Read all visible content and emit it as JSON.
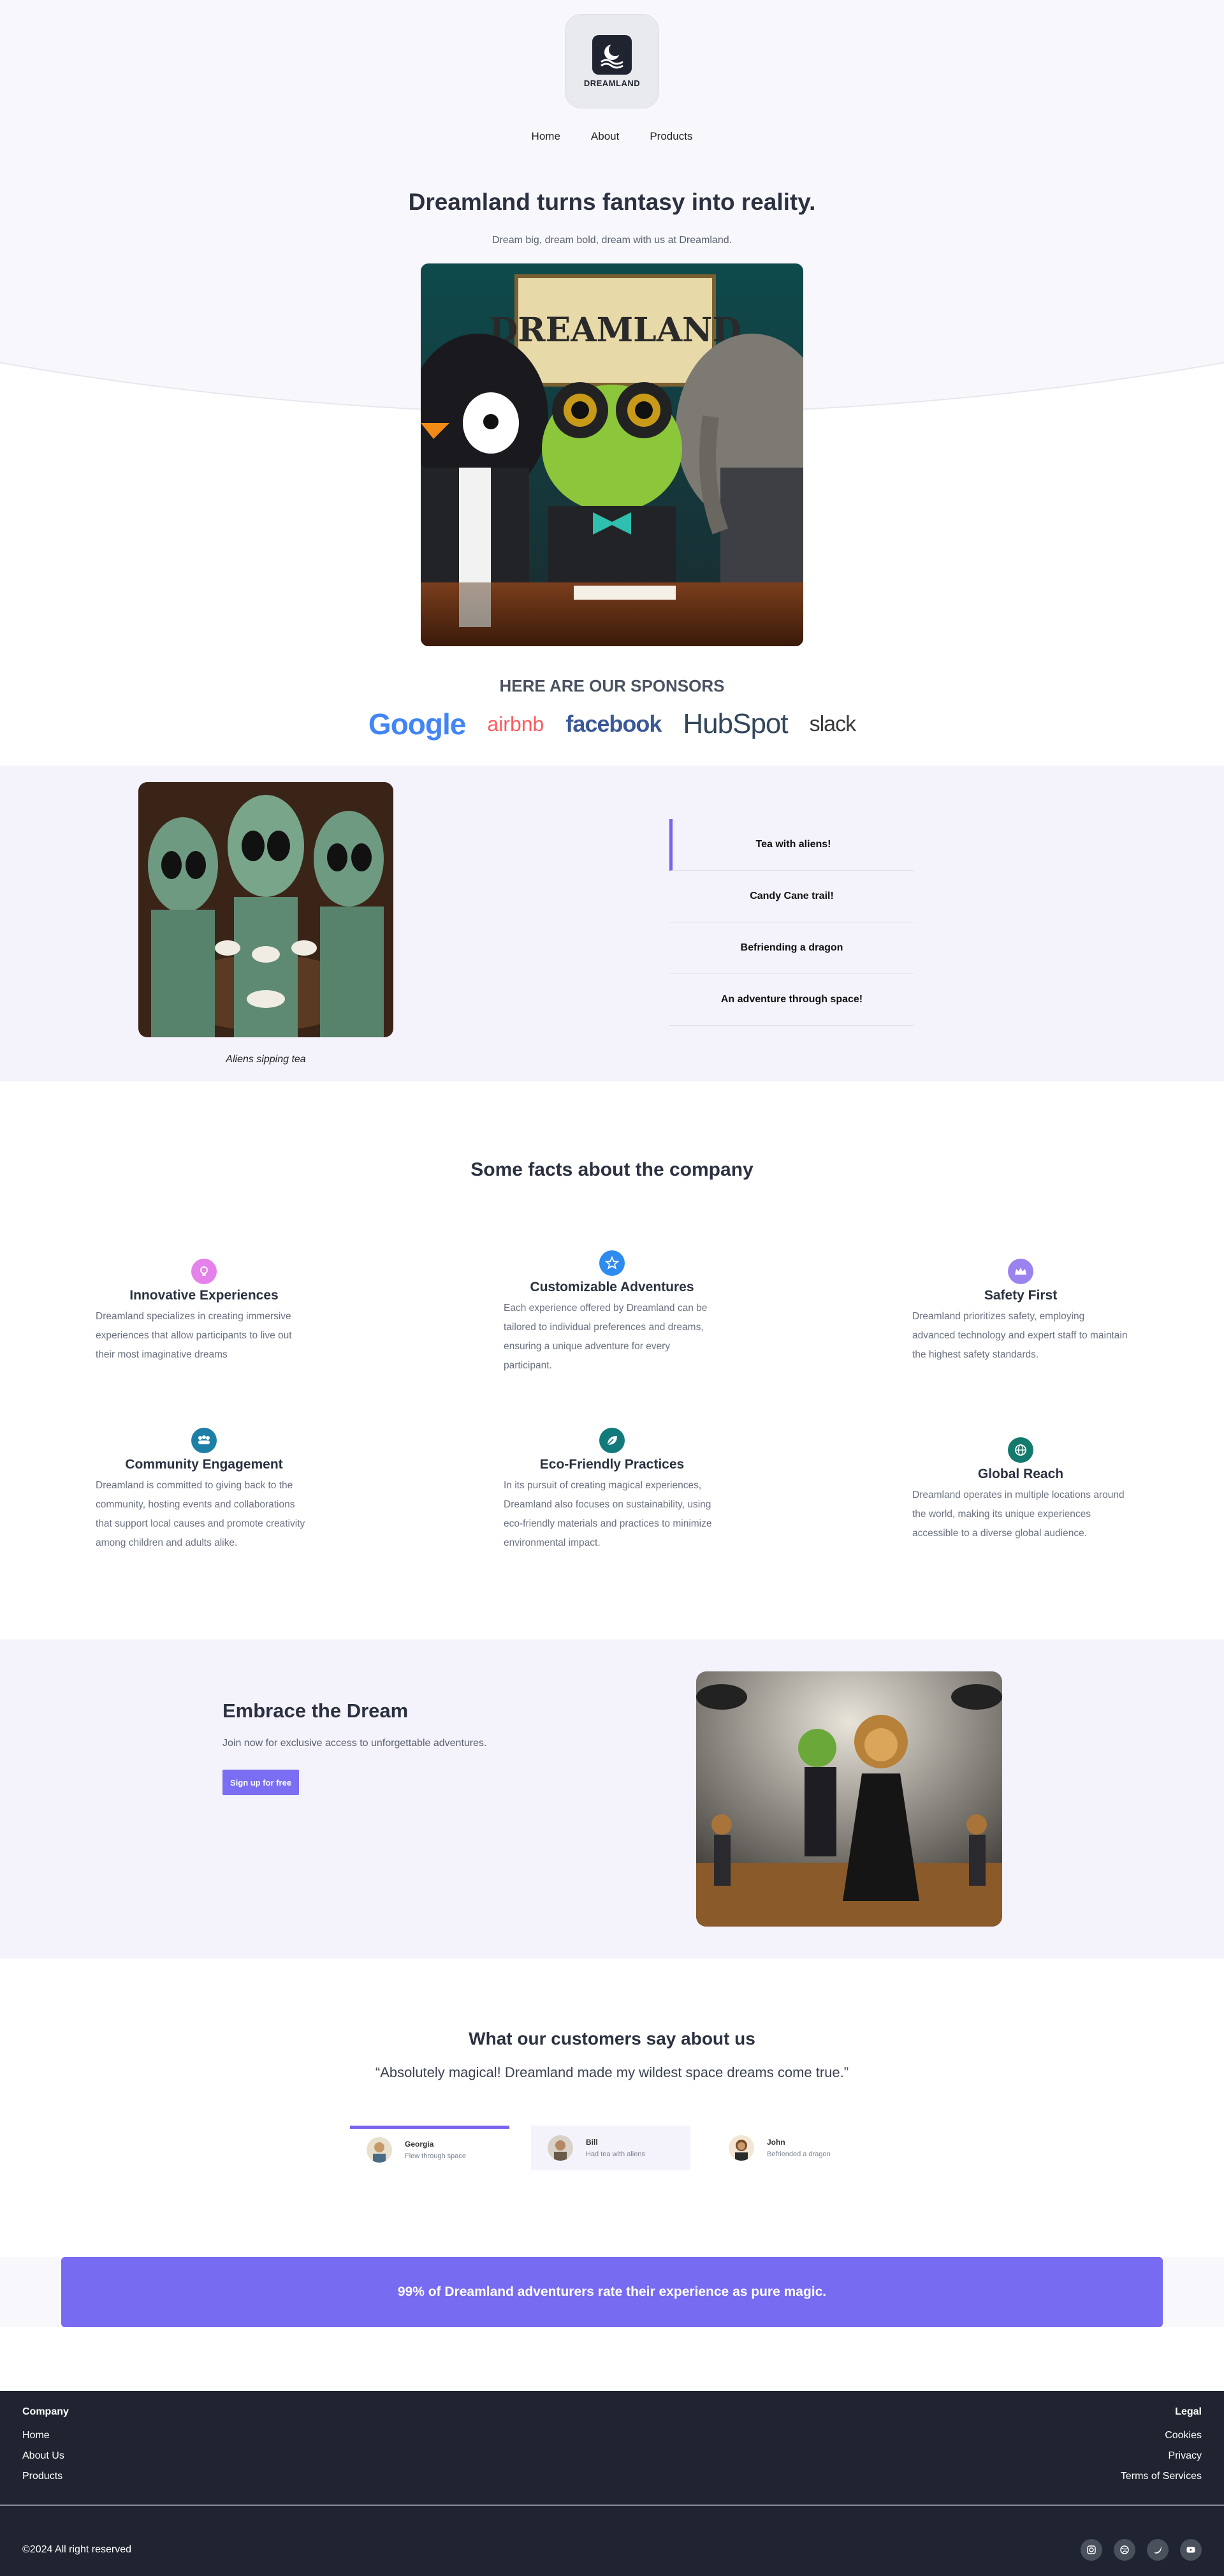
{
  "brand": {
    "logo_text": "DREAMLAND"
  },
  "nav": {
    "home": "Home",
    "about": "About",
    "products": "Products"
  },
  "hero": {
    "title": "Dreamland turns fantasy into reality.",
    "subtitle": "Dream big, dream bold, dream with us at Dreamland.",
    "sign_text": "DREAMLAND"
  },
  "sponsors": {
    "title": "HERE ARE OUR SPONSORS",
    "logos": [
      "Google",
      "airbnb",
      "facebook",
      "HubSpot",
      "slack"
    ]
  },
  "experiences": {
    "caption": "Aliens sipping tea",
    "tabs": [
      "Tea with aliens!",
      "Candy Cane trail!",
      "Befriending a dragon",
      "An adventure through space!"
    ],
    "active_tab": "Tea with aliens!"
  },
  "facts": {
    "title": "Some facts about the company",
    "items": [
      {
        "title": "Innovative Experiences",
        "text": "Dreamland specializes in creating immersive experiences that allow participants to live out their most imaginative dreams",
        "icon": "lightbulb-icon",
        "color": "#e581ea"
      },
      {
        "title": "Customizable Adventures",
        "text": "Each experience offered by Dreamland can be tailored to individual preferences and dreams, ensuring a unique adventure for every participant.",
        "icon": "star-icon",
        "color": "#2e8bef"
      },
      {
        "title": "Safety First",
        "text": "Dreamland prioritizes safety, employing advanced technology and expert staff to maintain the highest safety standards.",
        "icon": "crown-icon",
        "color": "#9b83ef"
      },
      {
        "title": "Community Engagement",
        "text": "Dreamland is committed to giving back to the community, hosting events and collaborations that support local causes and promote creativity among children and adults alike.",
        "icon": "people-icon",
        "color": "#1e7fa6"
      },
      {
        "title": "Eco-Friendly Practices",
        "text": "In its pursuit of creating magical experiences, Dreamland also focuses on sustainability, using eco-friendly materials and practices to minimize environmental impact.",
        "icon": "leaf-icon",
        "color": "#137a7c"
      },
      {
        "title": "Global Reach",
        "text": "Dreamland operates in multiple locations around the world, making its unique experiences accessible to a diverse global audience.",
        "icon": "globe-icon",
        "color": "#137a6d"
      }
    ]
  },
  "embrace": {
    "title": "Embrace the Dream",
    "text": "Join now for exclusive access to unforgettable adventures.",
    "button": "Sign up for free"
  },
  "testimonials": {
    "title": "What our customers say about us",
    "quote": "“Absolutely magical! Dreamland made my wildest space dreams come true.”",
    "people": [
      {
        "name": "Georgia",
        "role": "Flew through space"
      },
      {
        "name": "Bill",
        "role": "Had tea with aliens"
      },
      {
        "name": "John",
        "role": "Befriended a dragon"
      }
    ]
  },
  "stat": {
    "text": "99% of Dreamland adventurers rate their experience as pure magic."
  },
  "footer": {
    "company_head": "Company",
    "company_links": [
      "Home",
      "About Us",
      "Products"
    ],
    "legal_head": "Legal",
    "legal_links": [
      "Cookies",
      "Privacy",
      "Terms of Services"
    ],
    "copyright": "©2024 All right reserved",
    "socials": [
      "instagram-icon",
      "dribbble-icon",
      "twitter-icon",
      "youtube-icon"
    ]
  },
  "colors": {
    "accent": "#7b6ef2",
    "footer_bg": "#1f2430",
    "section_tint": "#f4f2fb"
  }
}
